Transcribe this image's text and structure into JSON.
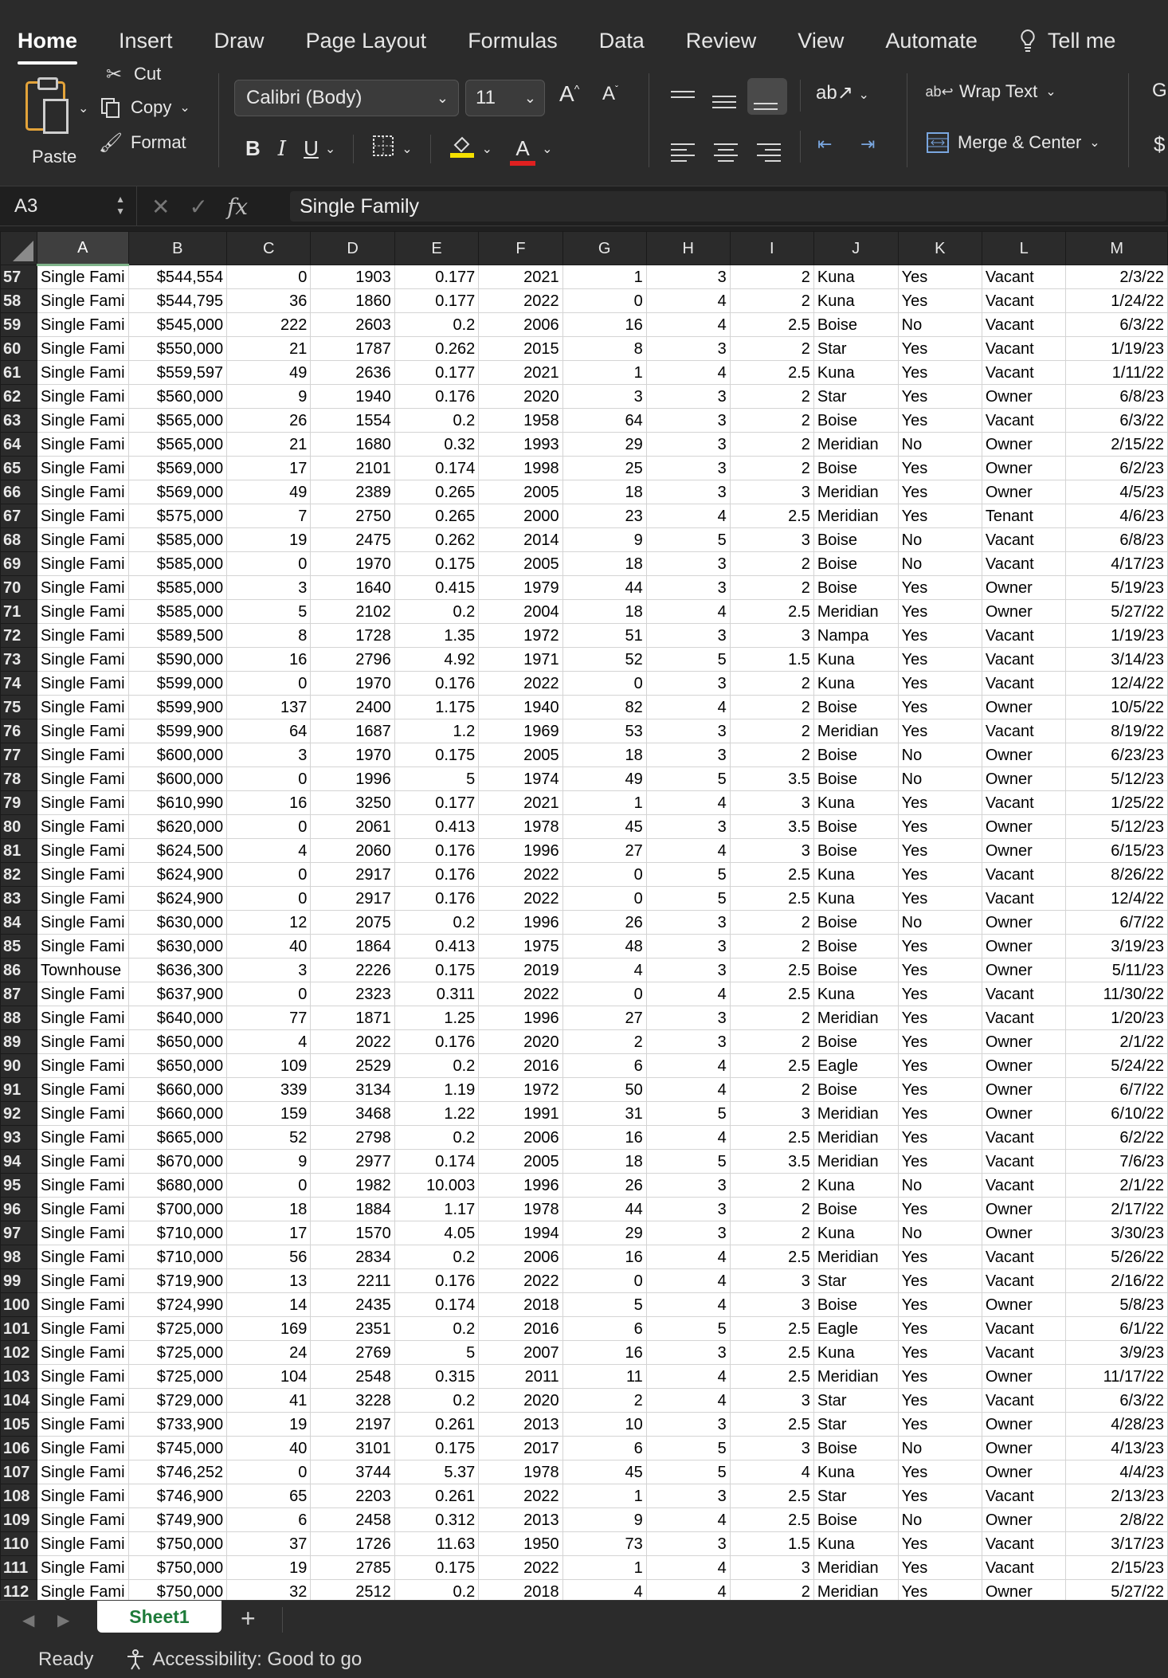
{
  "ribbon_tabs": [
    {
      "label": "Home",
      "active": true
    },
    {
      "label": "Insert"
    },
    {
      "label": "Draw"
    },
    {
      "label": "Page Layout"
    },
    {
      "label": "Formulas"
    },
    {
      "label": "Data"
    },
    {
      "label": "Review"
    },
    {
      "label": "View"
    },
    {
      "label": "Automate"
    },
    {
      "label": "Tell me"
    }
  ],
  "clipboard": {
    "paste": "Paste",
    "cut": "Cut",
    "copy": "Copy",
    "format": "Format"
  },
  "font": {
    "name": "Calibri (Body)",
    "size": "11"
  },
  "alignment": {
    "wrap_text": "Wrap Text",
    "merge_center": "Merge & Center",
    "next_group_letter": "G",
    "next_group_symbol": "$"
  },
  "formula_bar": {
    "cell_ref": "A3",
    "content": "Single Family"
  },
  "columns": [
    "A",
    "B",
    "C",
    "D",
    "E",
    "F",
    "G",
    "H",
    "I",
    "J",
    "K",
    "L",
    "M"
  ],
  "rows": [
    [
      "57",
      "Single Fami",
      "$544,554",
      "0",
      "1903",
      "0.177",
      "2021",
      "1",
      "3",
      "2",
      "Kuna",
      "Yes",
      "Vacant",
      "2/3/22"
    ],
    [
      "58",
      "Single Fami",
      "$544,795",
      "36",
      "1860",
      "0.177",
      "2022",
      "0",
      "4",
      "2",
      "Kuna",
      "Yes",
      "Vacant",
      "1/24/22"
    ],
    [
      "59",
      "Single Fami",
      "$545,000",
      "222",
      "2603",
      "0.2",
      "2006",
      "16",
      "4",
      "2.5",
      "Boise",
      "No",
      "Vacant",
      "6/3/22"
    ],
    [
      "60",
      "Single Fami",
      "$550,000",
      "21",
      "1787",
      "0.262",
      "2015",
      "8",
      "3",
      "2",
      "Star",
      "Yes",
      "Vacant",
      "1/19/23"
    ],
    [
      "61",
      "Single Fami",
      "$559,597",
      "49",
      "2636",
      "0.177",
      "2021",
      "1",
      "4",
      "2.5",
      "Kuna",
      "Yes",
      "Vacant",
      "1/11/22"
    ],
    [
      "62",
      "Single Fami",
      "$560,000",
      "9",
      "1940",
      "0.176",
      "2020",
      "3",
      "3",
      "2",
      "Star",
      "Yes",
      "Owner",
      "6/8/23"
    ],
    [
      "63",
      "Single Fami",
      "$565,000",
      "26",
      "1554",
      "0.2",
      "1958",
      "64",
      "3",
      "2",
      "Boise",
      "Yes",
      "Vacant",
      "6/3/22"
    ],
    [
      "64",
      "Single Fami",
      "$565,000",
      "21",
      "1680",
      "0.32",
      "1993",
      "29",
      "3",
      "2",
      "Meridian",
      "No",
      "Owner",
      "2/15/22"
    ],
    [
      "65",
      "Single Fami",
      "$569,000",
      "17",
      "2101",
      "0.174",
      "1998",
      "25",
      "3",
      "2",
      "Boise",
      "Yes",
      "Owner",
      "6/2/23"
    ],
    [
      "66",
      "Single Fami",
      "$569,000",
      "49",
      "2389",
      "0.265",
      "2005",
      "18",
      "3",
      "3",
      "Meridian",
      "Yes",
      "Owner",
      "4/5/23"
    ],
    [
      "67",
      "Single Fami",
      "$575,000",
      "7",
      "2750",
      "0.265",
      "2000",
      "23",
      "4",
      "2.5",
      "Meridian",
      "Yes",
      "Tenant",
      "4/6/23"
    ],
    [
      "68",
      "Single Fami",
      "$585,000",
      "19",
      "2475",
      "0.262",
      "2014",
      "9",
      "5",
      "3",
      "Boise",
      "No",
      "Vacant",
      "6/8/23"
    ],
    [
      "69",
      "Single Fami",
      "$585,000",
      "0",
      "1970",
      "0.175",
      "2005",
      "18",
      "3",
      "2",
      "Boise",
      "No",
      "Vacant",
      "4/17/23"
    ],
    [
      "70",
      "Single Fami",
      "$585,000",
      "3",
      "1640",
      "0.415",
      "1979",
      "44",
      "3",
      "2",
      "Boise",
      "Yes",
      "Owner",
      "5/19/23"
    ],
    [
      "71",
      "Single Fami",
      "$585,000",
      "5",
      "2102",
      "0.2",
      "2004",
      "18",
      "4",
      "2.5",
      "Meridian",
      "Yes",
      "Owner",
      "5/27/22"
    ],
    [
      "72",
      "Single Fami",
      "$589,500",
      "8",
      "1728",
      "1.35",
      "1972",
      "51",
      "3",
      "3",
      "Nampa",
      "Yes",
      "Vacant",
      "1/19/23"
    ],
    [
      "73",
      "Single Fami",
      "$590,000",
      "16",
      "2796",
      "4.92",
      "1971",
      "52",
      "5",
      "1.5",
      "Kuna",
      "Yes",
      "Vacant",
      "3/14/23"
    ],
    [
      "74",
      "Single Fami",
      "$599,000",
      "0",
      "1970",
      "0.176",
      "2022",
      "0",
      "3",
      "2",
      "Kuna",
      "Yes",
      "Vacant",
      "12/4/22"
    ],
    [
      "75",
      "Single Fami",
      "$599,900",
      "137",
      "2400",
      "1.175",
      "1940",
      "82",
      "4",
      "2",
      "Boise",
      "Yes",
      "Owner",
      "10/5/22"
    ],
    [
      "76",
      "Single Fami",
      "$599,900",
      "64",
      "1687",
      "1.2",
      "1969",
      "53",
      "3",
      "2",
      "Meridian",
      "Yes",
      "Vacant",
      "8/19/22"
    ],
    [
      "77",
      "Single Fami",
      "$600,000",
      "3",
      "1970",
      "0.175",
      "2005",
      "18",
      "3",
      "2",
      "Boise",
      "No",
      "Owner",
      "6/23/23"
    ],
    [
      "78",
      "Single Fami",
      "$600,000",
      "0",
      "1996",
      "5",
      "1974",
      "49",
      "5",
      "3.5",
      "Boise",
      "No",
      "Owner",
      "5/12/23"
    ],
    [
      "79",
      "Single Fami",
      "$610,990",
      "16",
      "3250",
      "0.177",
      "2021",
      "1",
      "4",
      "3",
      "Kuna",
      "Yes",
      "Vacant",
      "1/25/22"
    ],
    [
      "80",
      "Single Fami",
      "$620,000",
      "0",
      "2061",
      "0.413",
      "1978",
      "45",
      "3",
      "3.5",
      "Boise",
      "Yes",
      "Owner",
      "5/12/23"
    ],
    [
      "81",
      "Single Fami",
      "$624,500",
      "4",
      "2060",
      "0.176",
      "1996",
      "27",
      "4",
      "3",
      "Boise",
      "Yes",
      "Owner",
      "6/15/23"
    ],
    [
      "82",
      "Single Fami",
      "$624,900",
      "0",
      "2917",
      "0.176",
      "2022",
      "0",
      "5",
      "2.5",
      "Kuna",
      "Yes",
      "Vacant",
      "8/26/22"
    ],
    [
      "83",
      "Single Fami",
      "$624,900",
      "0",
      "2917",
      "0.176",
      "2022",
      "0",
      "5",
      "2.5",
      "Kuna",
      "Yes",
      "Vacant",
      "12/4/22"
    ],
    [
      "84",
      "Single Fami",
      "$630,000",
      "12",
      "2075",
      "0.2",
      "1996",
      "26",
      "3",
      "2",
      "Boise",
      "No",
      "Owner",
      "6/7/22"
    ],
    [
      "85",
      "Single Fami",
      "$630,000",
      "40",
      "1864",
      "0.413",
      "1975",
      "48",
      "3",
      "2",
      "Boise",
      "Yes",
      "Owner",
      "3/19/23"
    ],
    [
      "86",
      "Townhouse",
      "$636,300",
      "3",
      "2226",
      "0.175",
      "2019",
      "4",
      "3",
      "2.5",
      "Boise",
      "Yes",
      "Owner",
      "5/11/23"
    ],
    [
      "87",
      "Single Fami",
      "$637,900",
      "0",
      "2323",
      "0.311",
      "2022",
      "0",
      "4",
      "2.5",
      "Kuna",
      "Yes",
      "Vacant",
      "11/30/22"
    ],
    [
      "88",
      "Single Fami",
      "$640,000",
      "77",
      "1871",
      "1.25",
      "1996",
      "27",
      "3",
      "2",
      "Meridian",
      "Yes",
      "Vacant",
      "1/20/23"
    ],
    [
      "89",
      "Single Fami",
      "$650,000",
      "4",
      "2022",
      "0.176",
      "2020",
      "2",
      "3",
      "2",
      "Boise",
      "Yes",
      "Owner",
      "2/1/22"
    ],
    [
      "90",
      "Single Fami",
      "$650,000",
      "109",
      "2529",
      "0.2",
      "2016",
      "6",
      "4",
      "2.5",
      "Eagle",
      "Yes",
      "Owner",
      "5/24/22"
    ],
    [
      "91",
      "Single Fami",
      "$660,000",
      "339",
      "3134",
      "1.19",
      "1972",
      "50",
      "4",
      "2",
      "Boise",
      "Yes",
      "Owner",
      "6/7/22"
    ],
    [
      "92",
      "Single Fami",
      "$660,000",
      "159",
      "3468",
      "1.22",
      "1991",
      "31",
      "5",
      "3",
      "Meridian",
      "Yes",
      "Owner",
      "6/10/22"
    ],
    [
      "93",
      "Single Fami",
      "$665,000",
      "52",
      "2798",
      "0.2",
      "2006",
      "16",
      "4",
      "2.5",
      "Meridian",
      "Yes",
      "Vacant",
      "6/2/22"
    ],
    [
      "94",
      "Single Fami",
      "$670,000",
      "9",
      "2977",
      "0.174",
      "2005",
      "18",
      "5",
      "3.5",
      "Meridian",
      "Yes",
      "Vacant",
      "7/6/23"
    ],
    [
      "95",
      "Single Fami",
      "$680,000",
      "0",
      "1982",
      "10.003",
      "1996",
      "26",
      "3",
      "2",
      "Kuna",
      "No",
      "Vacant",
      "2/1/22"
    ],
    [
      "96",
      "Single Fami",
      "$700,000",
      "18",
      "1884",
      "1.17",
      "1978",
      "44",
      "3",
      "2",
      "Boise",
      "Yes",
      "Owner",
      "2/17/22"
    ],
    [
      "97",
      "Single Fami",
      "$710,000",
      "17",
      "1570",
      "4.05",
      "1994",
      "29",
      "3",
      "2",
      "Kuna",
      "No",
      "Owner",
      "3/30/23"
    ],
    [
      "98",
      "Single Fami",
      "$710,000",
      "56",
      "2834",
      "0.2",
      "2006",
      "16",
      "4",
      "2.5",
      "Meridian",
      "Yes",
      "Vacant",
      "5/26/22"
    ],
    [
      "99",
      "Single Fami",
      "$719,900",
      "13",
      "2211",
      "0.176",
      "2022",
      "0",
      "4",
      "3",
      "Star",
      "Yes",
      "Vacant",
      "2/16/22"
    ],
    [
      "100",
      "Single Fami",
      "$724,990",
      "14",
      "2435",
      "0.174",
      "2018",
      "5",
      "4",
      "3",
      "Boise",
      "Yes",
      "Owner",
      "5/8/23"
    ],
    [
      "101",
      "Single Fami",
      "$725,000",
      "169",
      "2351",
      "0.2",
      "2016",
      "6",
      "5",
      "2.5",
      "Eagle",
      "Yes",
      "Vacant",
      "6/1/22"
    ],
    [
      "102",
      "Single Fami",
      "$725,000",
      "24",
      "2769",
      "5",
      "2007",
      "16",
      "3",
      "2.5",
      "Kuna",
      "Yes",
      "Vacant",
      "3/9/23"
    ],
    [
      "103",
      "Single Fami",
      "$725,000",
      "104",
      "2548",
      "0.315",
      "2011",
      "11",
      "4",
      "2.5",
      "Meridian",
      "Yes",
      "Owner",
      "11/17/22"
    ],
    [
      "104",
      "Single Fami",
      "$729,000",
      "41",
      "3228",
      "0.2",
      "2020",
      "2",
      "4",
      "3",
      "Star",
      "Yes",
      "Vacant",
      "6/3/22"
    ],
    [
      "105",
      "Single Fami",
      "$733,900",
      "19",
      "2197",
      "0.261",
      "2013",
      "10",
      "3",
      "2.5",
      "Star",
      "Yes",
      "Owner",
      "4/28/23"
    ],
    [
      "106",
      "Single Fami",
      "$745,000",
      "40",
      "3101",
      "0.175",
      "2017",
      "6",
      "5",
      "3",
      "Boise",
      "No",
      "Owner",
      "4/13/23"
    ],
    [
      "107",
      "Single Fami",
      "$746,252",
      "0",
      "3744",
      "5.37",
      "1978",
      "45",
      "5",
      "4",
      "Kuna",
      "Yes",
      "Owner",
      "4/4/23"
    ],
    [
      "108",
      "Single Fami",
      "$746,900",
      "65",
      "2203",
      "0.261",
      "2022",
      "1",
      "3",
      "2.5",
      "Star",
      "Yes",
      "Vacant",
      "2/13/23"
    ],
    [
      "109",
      "Single Fami",
      "$749,900",
      "6",
      "2458",
      "0.312",
      "2013",
      "9",
      "4",
      "2.5",
      "Boise",
      "No",
      "Owner",
      "2/8/22"
    ],
    [
      "110",
      "Single Fami",
      "$750,000",
      "37",
      "1726",
      "11.63",
      "1950",
      "73",
      "3",
      "1.5",
      "Kuna",
      "Yes",
      "Vacant",
      "3/17/23"
    ],
    [
      "111",
      "Single Fami",
      "$750,000",
      "19",
      "2785",
      "0.175",
      "2022",
      "1",
      "4",
      "3",
      "Meridian",
      "Yes",
      "Vacant",
      "2/15/23"
    ],
    [
      "112",
      "Single Fami",
      "$750,000",
      "32",
      "2512",
      "0.2",
      "2018",
      "4",
      "4",
      "2",
      "Meridian",
      "Yes",
      "Owner",
      "5/27/22"
    ]
  ],
  "sheet_tabs": [
    {
      "label": "Sheet1",
      "active": true
    }
  ],
  "status": {
    "ready": "Ready",
    "accessibility": "Accessibility: Good to go"
  },
  "colors": {
    "accent_green": "#1e7b3a",
    "chrome_bg": "#2b2b2b",
    "grid_line": "#d4d4d4"
  }
}
